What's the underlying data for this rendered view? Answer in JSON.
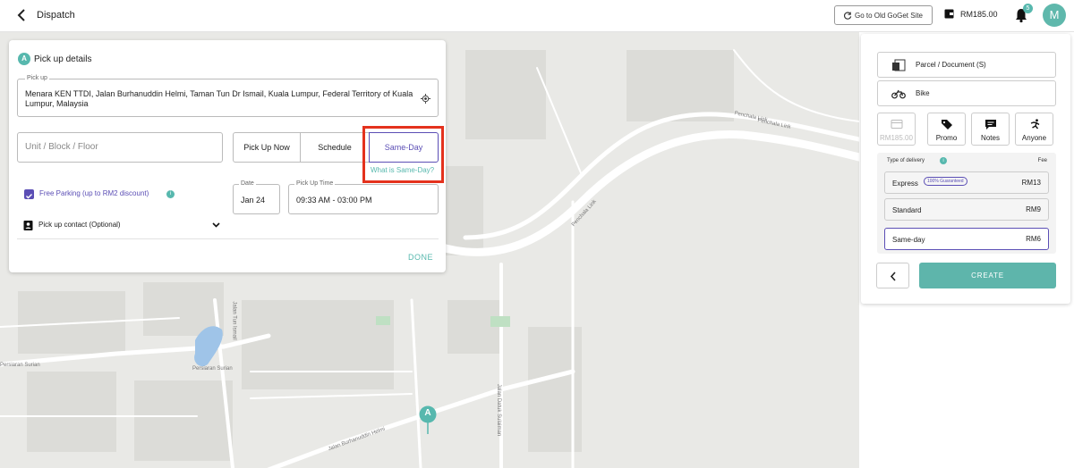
{
  "header": {
    "title": "Dispatch",
    "old_site_label": "Go to Old GoGet Site",
    "wallet_balance": "RM185.00",
    "notification_count": "5",
    "avatar_initial": "M"
  },
  "map": {
    "labels": [
      "Penchala Link",
      "Penchala Link",
      "Penchala Link",
      "Persiaran Surian",
      "Persiaran Surian",
      "Jalan Burhanuddin Helmi",
      "Jalan Tun Ismail",
      "Jalan Datuk Sulaiman"
    ],
    "marker_label": "A"
  },
  "pickup": {
    "badge": "A",
    "title": "Pick up details",
    "field_label": "Pick up",
    "address": "Menara KEN TTDI, Jalan Burhanuddin Helmi, Taman Tun Dr Ismail, Kuala Lumpur, Federal Territory of Kuala Lumpur, Malaysia",
    "unit_placeholder": "Unit / Block / Floor",
    "modes": [
      "Pick Up Now",
      "Schedule",
      "Same-Day"
    ],
    "what_is_link": "What is Same-Day?",
    "free_parking_label": "Free Parking (up to RM2 discount)",
    "date_label": "Date",
    "date_value": "Jan 24",
    "time_label": "Pick Up Time",
    "time_value": "09:33 AM - 03:00 PM",
    "contact_label": "Pick up contact (Optional)",
    "done_label": "DONE"
  },
  "panel": {
    "item_type": "Parcel / Document (S)",
    "vehicle": "Bike",
    "tiles": [
      "RM185.00",
      "Promo",
      "Notes",
      "Anyone"
    ],
    "delivery_header": "Type of delivery",
    "fee_header": "Fee",
    "delivery_options": [
      {
        "name": "Express",
        "badge": "100% Guaranteed",
        "price": "RM13"
      },
      {
        "name": "Standard",
        "price": "RM9"
      },
      {
        "name": "Same-day",
        "price": "RM6"
      }
    ],
    "create_label": "CREATE"
  },
  "colors": {
    "accent": "#57b8ae",
    "selected": "#5b4eb5",
    "highlight": "#e4321d"
  }
}
